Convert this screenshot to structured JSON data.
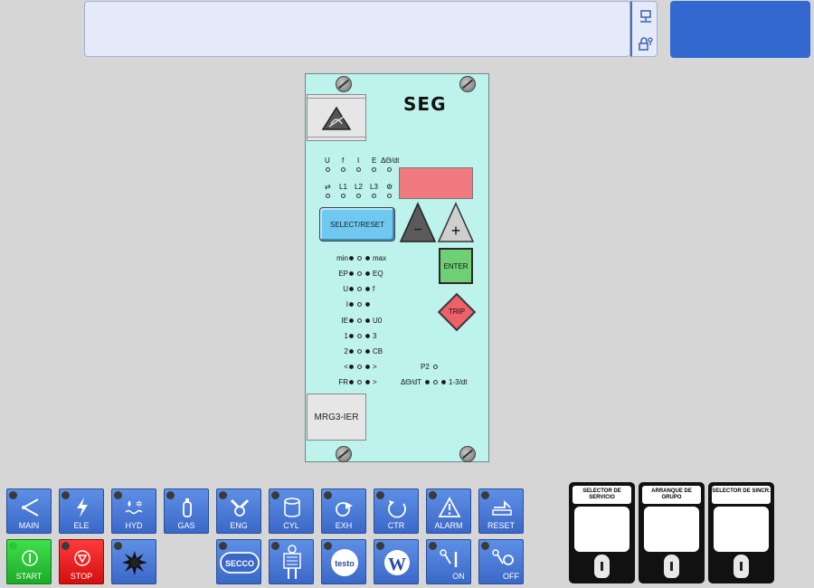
{
  "relay": {
    "brand": "SEG",
    "model": "MRG3-IER",
    "led_row1_labels": [
      "U",
      "f",
      "I",
      "E",
      "ΔΘ/dt"
    ],
    "led_row2_labels": [
      "⇄",
      "L1",
      "L2",
      "L3",
      "⚙"
    ],
    "select_reset_label": "SELECT/RESET",
    "minus_label": "−",
    "plus_label": "+",
    "enter_label": "ENTER",
    "trip_label": "TRIP",
    "indicators": [
      {
        "left": "min",
        "right": "max"
      },
      {
        "left": "EP",
        "right": "EQ"
      },
      {
        "left": "U",
        "right": "f"
      },
      {
        "left": "I",
        "right": ""
      },
      {
        "left": "IE",
        "right": "U0"
      },
      {
        "left": "1",
        "right": "3"
      },
      {
        "left": "2",
        "right": "CB"
      },
      {
        "left": "<",
        "right": ">"
      },
      {
        "left": "FR",
        "right": ">"
      }
    ],
    "p2_label": "P2",
    "dtheta_label": "ΔΘ/dT",
    "dtheta_right": "1-3/dt"
  },
  "nav_buttons_row1": [
    {
      "label": "MAIN",
      "icon": "speaker-icon"
    },
    {
      "label": "ELE",
      "icon": "lightning-icon"
    },
    {
      "label": "HYD",
      "icon": "hydraulic-icon"
    },
    {
      "label": "GAS",
      "icon": "gas-cylinder-icon"
    },
    {
      "label": "ENG",
      "icon": "engine-icon"
    },
    {
      "label": "CYL",
      "icon": "cylinder-icon"
    },
    {
      "label": "EXH",
      "icon": "exhaust-icon"
    },
    {
      "label": "CTR",
      "icon": "control-icon"
    },
    {
      "label": "ALARM",
      "icon": "alarm-icon"
    },
    {
      "label": "RESET",
      "icon": "reset-icon"
    }
  ],
  "nav_buttons_row2": [
    {
      "label": "START",
      "icon": "start-icon"
    },
    {
      "label": "STOP",
      "icon": "stop-icon"
    },
    {
      "label": "",
      "icon": "splash-icon"
    },
    {
      "label": "SECCO",
      "icon": "secco-logo-icon"
    },
    {
      "label": "",
      "icon": "xray-icon"
    },
    {
      "label": "testo",
      "icon": "testo-logo-icon"
    },
    {
      "label": "W",
      "icon": "w-logo-icon"
    },
    {
      "label": "ON",
      "icon": "key-on-icon"
    },
    {
      "label": "OFF",
      "icon": "key-off-icon"
    }
  ],
  "selectors": [
    {
      "title": "SELECTOR DE SERVICIO"
    },
    {
      "title": "ARRANQUE DE GRUPO"
    },
    {
      "title": "SELECTOR DE SINCR."
    }
  ],
  "colors": {
    "accent": "#3268cf",
    "display": "#f07a80",
    "relay_panel": "#bdf3ec"
  }
}
